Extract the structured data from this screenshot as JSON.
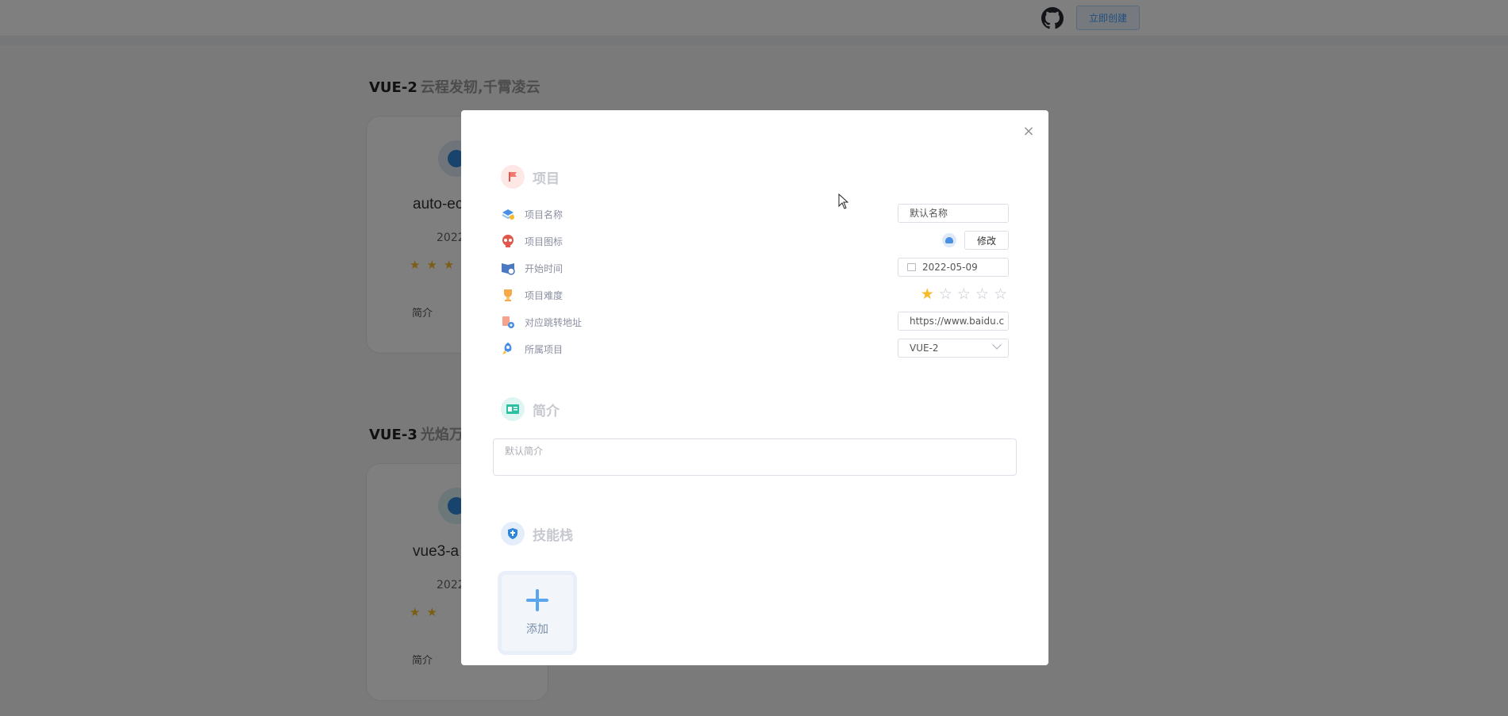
{
  "header": {
    "create_label": "立即创建"
  },
  "sections": [
    {
      "title": "VUE-2",
      "subtitle": "云程发轫,千霄凌云",
      "card": {
        "name": "auto-ec",
        "date": "2022",
        "stars": 3,
        "intro_label": "简介"
      }
    },
    {
      "title": "VUE-3",
      "subtitle": "光焰万",
      "card": {
        "name": "vue3-a",
        "date": "2022",
        "stars": 2,
        "intro_label": "简介"
      }
    }
  ],
  "dialog": {
    "close_glyph": "×",
    "project_group": "项目",
    "fields": {
      "name": {
        "label": "项目名称",
        "value": "默认名称"
      },
      "icon": {
        "label": "项目图标",
        "button": "修改"
      },
      "start": {
        "label": "开始时间",
        "value": "2022-05-09"
      },
      "difficulty": {
        "label": "项目难度",
        "rating": 1,
        "max": 5
      },
      "url": {
        "label": "对应跳转地址",
        "value": "https://www.baidu.c"
      },
      "belongs": {
        "label": "所属项目",
        "value": "VUE-2"
      }
    },
    "intro_group": "简介",
    "intro_placeholder": "默认简介",
    "skills_group": "技能栈",
    "add_label": "添加"
  },
  "colors": {
    "accent": "#409eff",
    "star": "#f7ba2a",
    "overlay": "rgba(0,0,0,0.5)"
  }
}
